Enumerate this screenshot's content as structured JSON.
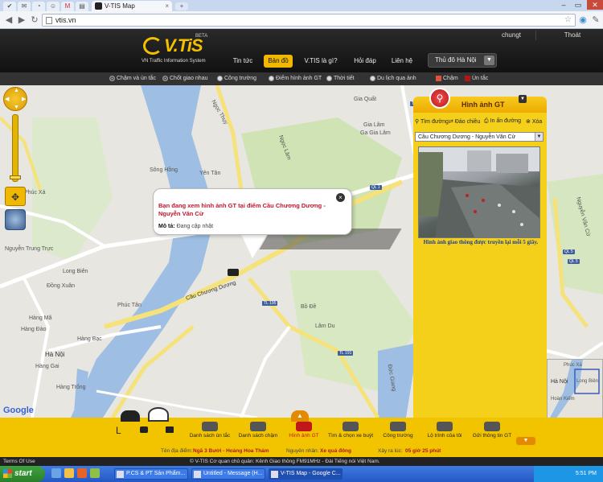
{
  "browser": {
    "tab_title": "V-TIS Map",
    "url": "vtis.vn"
  },
  "site": {
    "logo_text": "V.TiS",
    "logo_beta": "BETA",
    "logo_tagline": "VN Traffic Information System",
    "user": "chungt",
    "logout": "Thoát",
    "nav": [
      "Tin tức",
      "Bản đồ",
      "V.TIS là gì?",
      "Hỏi đáp",
      "Liên hệ"
    ],
    "city": "Thủ đô Hà Nội"
  },
  "filters": [
    {
      "label": "Chậm và ùn tắc",
      "on": true
    },
    {
      "label": "Chốt giao nhau",
      "on": true
    },
    {
      "label": "Công trường",
      "on": false
    },
    {
      "label": "Điểm hình ảnh GT",
      "on": false
    },
    {
      "label": "Thời tiết",
      "on": false
    },
    {
      "label": "Du lịch qua ảnh",
      "on": false
    },
    {
      "label": "Chậm",
      "color": "#e0523a"
    },
    {
      "label": "Ùn tắc",
      "color": "#b01818"
    }
  ],
  "map": {
    "labels": {
      "song_hong": "Sông Hồng",
      "ha_noi": "Hà Nội",
      "gia_quat": "Gia Quất",
      "gia_lam": "Gia Lâm",
      "gia_lam2": "Ga Gia Lâm",
      "ngoc_thuy": "Ngọc Thụy",
      "yen_tan": "Yên Tân",
      "phuc_xa": "Phúc Xá",
      "nguyen_trung_truc": "Nguyễn Trung Trực",
      "long_bien": "Long Biên",
      "dong_xuan": "Đồng Xuân",
      "hang_ma": "Hàng Mã",
      "hang_dao": "Hàng Đào",
      "hang_bac": "Hàng Bạc",
      "hang_gai": "Hàng Gai",
      "hang_trong": "Hàng Trống",
      "phuc_tan": "Phúc Tân",
      "bo_de": "Bồ Đề",
      "lam_du": "Lâm Du",
      "cau_chuong_duong": "Cầu Chương Dương",
      "ngoc_lam": "Ngọc Lâm",
      "nguyen_van_cu": "Nguyễn Văn Cừ",
      "duc_giang": "Đức Giang",
      "hoan_kiem": "Hoàn Kiếm"
    },
    "shields": [
      "TL 195",
      "TL 191",
      "QL 1",
      "QL 5",
      "QL 5",
      "TL 181"
    ],
    "google": "Google"
  },
  "popup": {
    "title": "Bạn đang xem hình ảnh GT tại điểm Cầu Chương Dương - Nguyễn Văn Cừ",
    "desc_label": "Mô tả:",
    "desc_value": "Đang cập nhật"
  },
  "panel": {
    "title": "Hình ảnh GT",
    "tools": [
      "Tìm đường",
      "Đảo chiều",
      "In ấn đường",
      "Xóa"
    ],
    "select": "Cầu Chương Dương - Nguyễn Văn Cừ",
    "caption": "Hình ảnh giao thông được truyền lại mỗi 5 giây."
  },
  "overview": {
    "phuc_xa": "Phúc Xá",
    "long_bien": "Long Biên",
    "ha_noi": "Hà Nội",
    "hoan_kiem": "Hoàn Kiếm"
  },
  "bottom": {
    "items": [
      "Danh sách ùn tắc",
      "Danh sách chậm",
      "Hình ảnh GT",
      "Tìm & chọn xe buýt",
      "Công trường",
      "Lộ trình của tôi",
      "Gửi thông tin GT"
    ],
    "stats": {
      "street_label": "Tên địa điểm:",
      "street_value": "Ngã 3 Bưởi - Hoàng Hoa Thám",
      "cause_label": "Nguyên nhân:",
      "cause_value": "Xe quá đông",
      "time_label": "Xảy ra lúc:",
      "time_value": "05 giờ 25 phút"
    }
  },
  "footer": {
    "terms": "Terms Of Use",
    "copyright": "© V-TIS Cơ quan chủ quản: Kênh Giao thông FM91MHz - Đài Tiếng nói Việt Nam."
  },
  "taskbar": {
    "start": "start",
    "items": [
      "P.CS & PT Sản Phẩm...",
      "Untitled - Message (H...",
      "V-TIS Map - Google C..."
    ],
    "time": "5:51 PM"
  }
}
